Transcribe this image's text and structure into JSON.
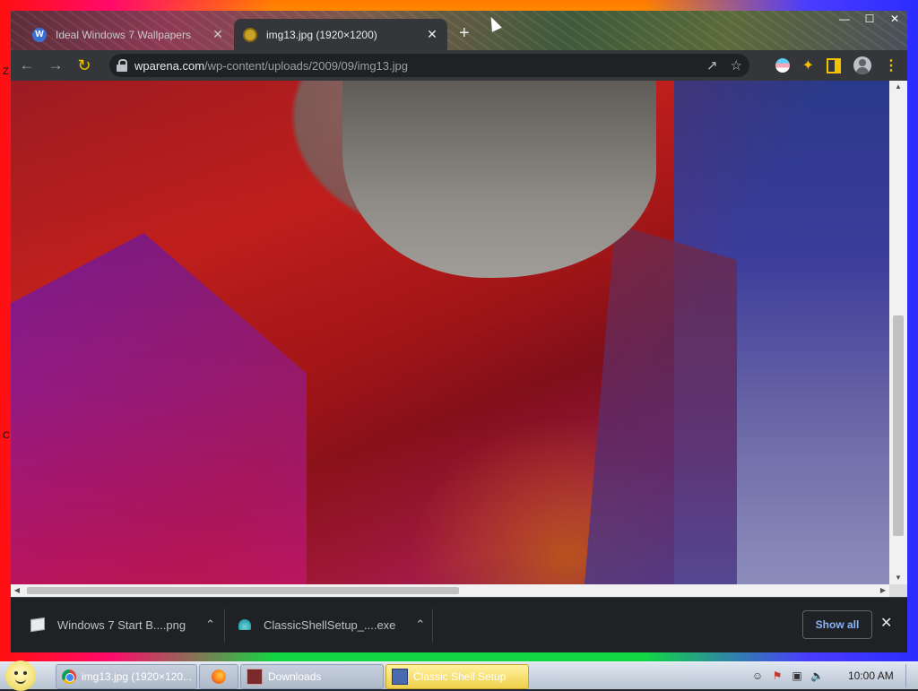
{
  "browser": {
    "tabs": [
      {
        "title": "Ideal Windows 7 Wallpapers",
        "favicon": "wordpress-icon",
        "active": false
      },
      {
        "title": "img13.jpg (1920×1200)",
        "favicon": "image-icon",
        "active": true
      }
    ],
    "new_tab_symbol": "+",
    "window_controls": {
      "minimize": "—",
      "maximize": "☐",
      "close": "✕"
    },
    "address_bar": {
      "host": "wparena.com",
      "path": "/wp-content/uploads/2009/09/img13.jpg"
    },
    "toolbar_icons": [
      "back-icon",
      "forward-icon",
      "reload-icon",
      "lock-icon",
      "share-icon",
      "bookmark-star-icon",
      "extension-flag-icon",
      "puzzle-icon",
      "side-panel-icon",
      "profile-icon",
      "menu-icon"
    ],
    "scroll": {
      "vertical_fraction": 0.54,
      "horizontal_fraction": 0.0
    }
  },
  "download_shelf": {
    "items": [
      {
        "name": "Windows 7 Start B....png",
        "icon": "png-file-icon"
      },
      {
        "name": "ClassicShellSetup_....exe",
        "icon": "classic-shell-icon"
      }
    ],
    "show_all_label": "Show all",
    "close_symbol": "✕"
  },
  "taskbar": {
    "buttons": [
      {
        "label": "img13.jpg (1920×120...",
        "icon": "chrome-icon",
        "active": false
      },
      {
        "label": "",
        "icon": "firefox-icon",
        "active": false
      },
      {
        "label": "Downloads",
        "icon": "downloads-folder-icon",
        "active": false
      },
      {
        "label": "Classic Shell Setup",
        "icon": "setup-icon",
        "active": true
      }
    ],
    "clock": "10:00 AM"
  },
  "desktop": {
    "edge_letters": [
      "Z",
      "C"
    ]
  },
  "colors": {
    "accent_link": "#8ab4f8",
    "toolbar_yellow": "#f2c200",
    "active_task": "#f0cf4a"
  }
}
